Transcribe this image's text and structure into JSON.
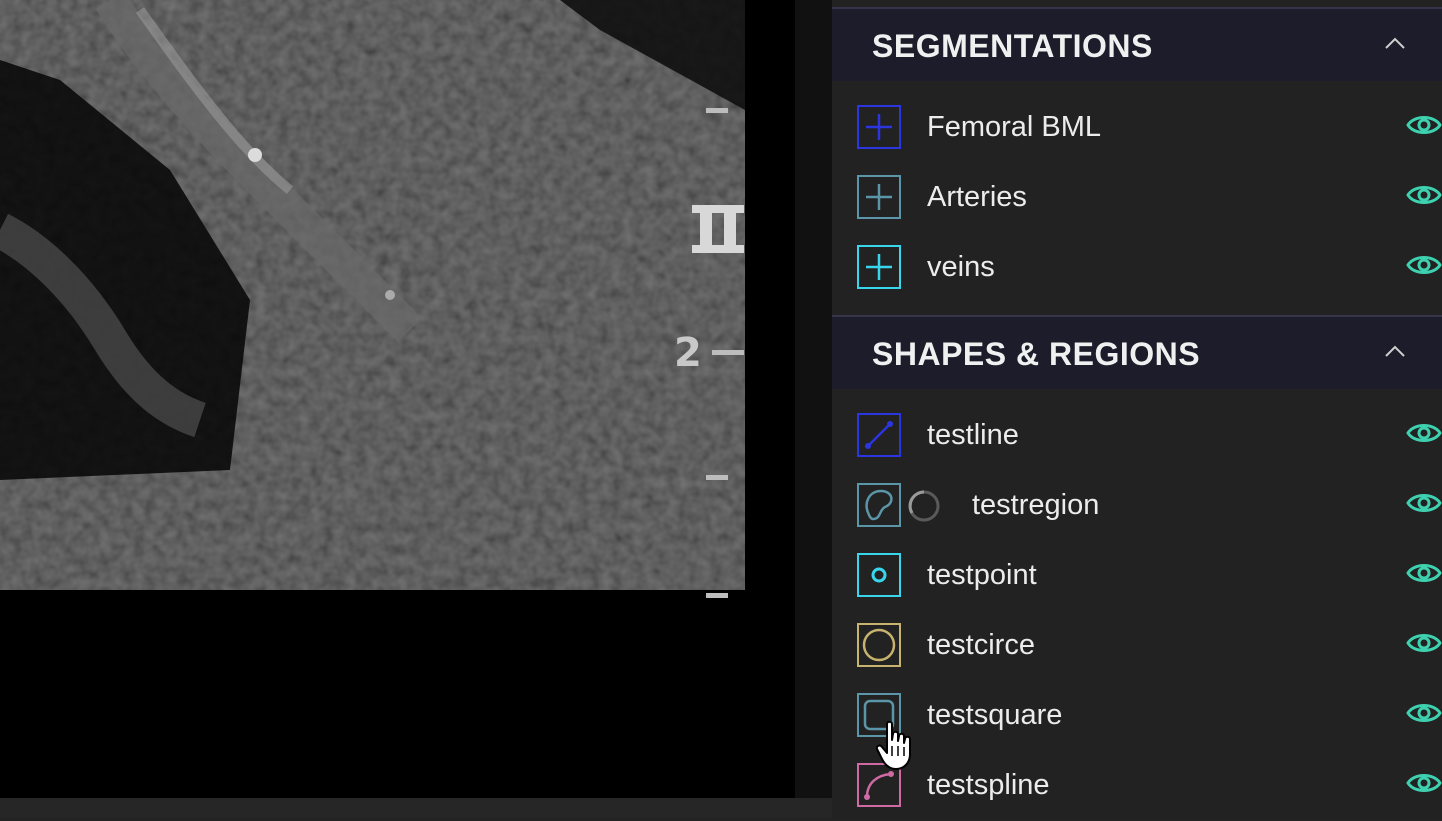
{
  "viewer": {
    "scale_marker": "2"
  },
  "colors": {
    "eye_visible": "#3ed1b0",
    "header_bg": "#1c1c2a",
    "panel_bg": "#222222"
  },
  "sections": [
    {
      "title": "SEGMENTATIONS",
      "items": [
        {
          "label": "Femoral BML",
          "icon": "plus-icon",
          "color": "#2b35e0",
          "visible": true
        },
        {
          "label": "Arteries",
          "icon": "plus-icon",
          "color": "#5b95a8",
          "visible": true
        },
        {
          "label": "veins",
          "icon": "plus-icon",
          "color": "#38d6ec",
          "visible": true
        }
      ]
    },
    {
      "title": "SHAPES & REGIONS",
      "items": [
        {
          "label": "testline",
          "icon": "line-icon",
          "color": "#2b35e0",
          "visible": true
        },
        {
          "label": "testregion",
          "icon": "region-icon",
          "color": "#5b95a8",
          "visible": true,
          "loading": true
        },
        {
          "label": "testpoint",
          "icon": "point-icon",
          "color": "#38d6ec",
          "visible": true
        },
        {
          "label": "testcirce",
          "icon": "circle-icon",
          "color": "#c7b36e",
          "visible": true
        },
        {
          "label": "testsquare",
          "icon": "square-icon",
          "color": "#5b95a8",
          "visible": true
        },
        {
          "label": "testspline",
          "icon": "spline-icon",
          "color": "#cf6aa4",
          "visible": true
        }
      ]
    }
  ]
}
